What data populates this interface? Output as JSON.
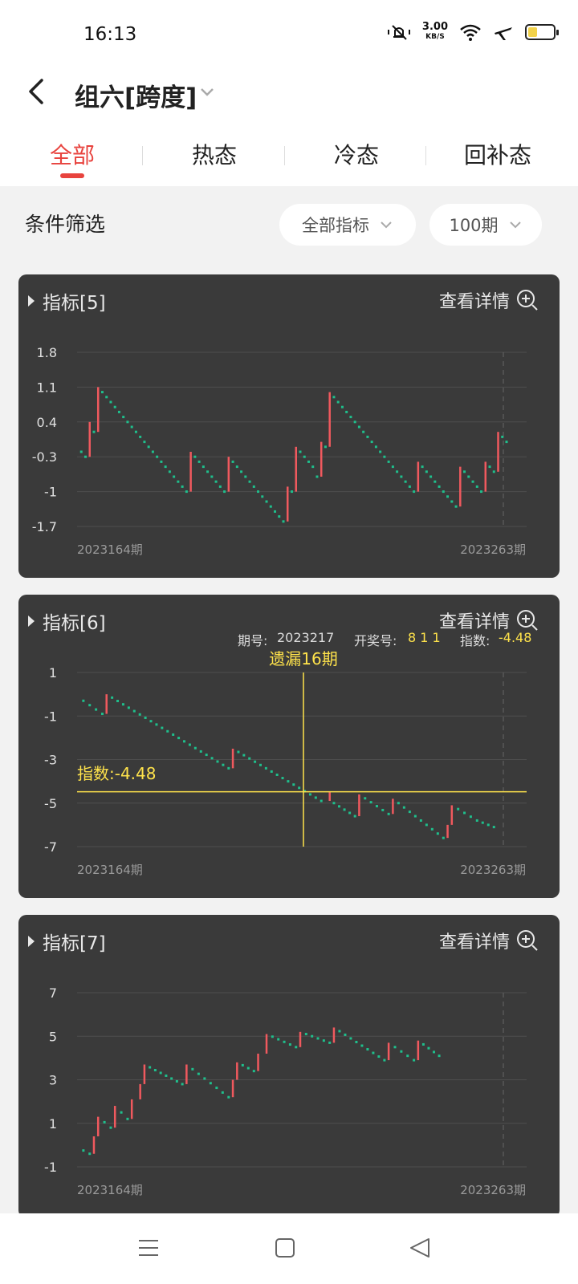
{
  "status": {
    "time": "16:13",
    "net_speed": "3.00",
    "net_unit": "KB/S",
    "battery_level": 0.35
  },
  "header": {
    "title": "组六[跨度]"
  },
  "tabs": [
    {
      "label": "全部"
    },
    {
      "label": "热态"
    },
    {
      "label": "冷态"
    },
    {
      "label": "回补态"
    }
  ],
  "filter": {
    "label": "条件筛选",
    "metric": "全部指标",
    "period": "100期"
  },
  "colors": {
    "accent": "#e8433e",
    "rise": "#f0595e",
    "fall": "#1fbf8c",
    "highlight": "#ffe34b",
    "card_bg": "#3a3a3a"
  },
  "cards": [
    {
      "title": "指标[5]",
      "detail": "查看详情",
      "x_start": "2023164期",
      "x_end": "2023263期"
    },
    {
      "title": "指标[6]",
      "detail": "查看详情",
      "x_start": "2023164期",
      "x_end": "2023263期",
      "tooltip": {
        "issue_label": "期号:",
        "issue": "2023217",
        "draw_label": "开奖号:",
        "draw": "8 1 1",
        "index_label": "指数:",
        "index": "-4.48"
      },
      "cursor_label": "遗漏16期",
      "cursor_value_label": "指数:-4.48"
    },
    {
      "title": "指标[7]",
      "detail": "查看详情",
      "x_start": "2023164期",
      "x_end": "2023263期"
    }
  ],
  "chart_data": [
    {
      "type": "line",
      "title": "指标[5]",
      "yticks": [
        "1.8",
        "1.1",
        "0.4",
        "-0.3",
        "-1",
        "-1.7"
      ],
      "ylim": [
        -1.7,
        1.8
      ],
      "x": [
        "2023164期",
        "2023263期"
      ],
      "series": [
        {
          "points": [
            [
              0,
              -0.1
            ],
            [
              1,
              -0.2
            ],
            [
              2,
              -0.3
            ],
            [
              3,
              0.4
            ],
            [
              4,
              0.2
            ],
            [
              5,
              1.1
            ],
            [
              6,
              1.0
            ],
            [
              7,
              0.9
            ],
            [
              8,
              0.8
            ],
            [
              9,
              0.7
            ],
            [
              10,
              0.6
            ],
            [
              11,
              0.5
            ],
            [
              12,
              0.4
            ],
            [
              13,
              0.3
            ],
            [
              14,
              0.2
            ],
            [
              15,
              0.1
            ],
            [
              16,
              0.0
            ],
            [
              17,
              -0.1
            ],
            [
              18,
              -0.2
            ],
            [
              19,
              -0.3
            ],
            [
              20,
              -0.4
            ],
            [
              21,
              -0.5
            ],
            [
              22,
              -0.6
            ],
            [
              23,
              -0.7
            ],
            [
              24,
              -0.8
            ],
            [
              25,
              -0.9
            ],
            [
              26,
              -1.0
            ],
            [
              27,
              -0.2
            ],
            [
              28,
              -0.3
            ],
            [
              29,
              -0.4
            ],
            [
              30,
              -0.5
            ],
            [
              31,
              -0.6
            ],
            [
              32,
              -0.7
            ],
            [
              33,
              -0.8
            ],
            [
              34,
              -0.9
            ],
            [
              35,
              -1.0
            ],
            [
              36,
              -0.3
            ],
            [
              37,
              -0.4
            ],
            [
              38,
              -0.5
            ],
            [
              39,
              -0.6
            ],
            [
              40,
              -0.7
            ],
            [
              41,
              -0.8
            ],
            [
              42,
              -0.9
            ],
            [
              43,
              -1.0
            ],
            [
              44,
              -1.1
            ],
            [
              45,
              -1.2
            ],
            [
              46,
              -1.3
            ],
            [
              47,
              -1.4
            ],
            [
              48,
              -1.5
            ],
            [
              49,
              -1.6
            ],
            [
              50,
              -0.9
            ],
            [
              51,
              -1.0
            ],
            [
              52,
              -0.1
            ],
            [
              53,
              -0.2
            ],
            [
              54,
              -0.3
            ],
            [
              55,
              -0.4
            ],
            [
              56,
              -0.5
            ],
            [
              57,
              -0.7
            ],
            [
              58,
              0.0
            ],
            [
              59,
              -0.1
            ],
            [
              60,
              1.0
            ],
            [
              61,
              0.9
            ],
            [
              62,
              0.8
            ],
            [
              63,
              0.7
            ],
            [
              64,
              0.6
            ],
            [
              65,
              0.5
            ],
            [
              66,
              0.4
            ],
            [
              67,
              0.3
            ],
            [
              68,
              0.2
            ],
            [
              69,
              0.1
            ],
            [
              70,
              0.0
            ],
            [
              71,
              -0.1
            ],
            [
              72,
              -0.2
            ],
            [
              73,
              -0.3
            ],
            [
              74,
              -0.4
            ],
            [
              75,
              -0.5
            ],
            [
              76,
              -0.6
            ],
            [
              77,
              -0.7
            ],
            [
              78,
              -0.8
            ],
            [
              79,
              -0.9
            ],
            [
              80,
              -1.0
            ],
            [
              81,
              -0.4
            ],
            [
              82,
              -0.5
            ],
            [
              83,
              -0.6
            ],
            [
              84,
              -0.7
            ],
            [
              85,
              -0.8
            ],
            [
              86,
              -0.9
            ],
            [
              87,
              -1.0
            ],
            [
              88,
              -1.1
            ],
            [
              89,
              -1.2
            ],
            [
              90,
              -1.3
            ],
            [
              91,
              -0.5
            ],
            [
              92,
              -0.6
            ],
            [
              93,
              -0.7
            ],
            [
              94,
              -0.8
            ],
            [
              95,
              -0.9
            ],
            [
              96,
              -1.0
            ],
            [
              97,
              -0.4
            ],
            [
              98,
              -0.5
            ],
            [
              99,
              -0.6
            ],
            [
              100,
              0.2
            ],
            [
              101,
              0.1
            ],
            [
              102,
              0.0
            ]
          ]
        }
      ]
    },
    {
      "type": "line",
      "title": "指标[6]",
      "yticks": [
        "1",
        "-1",
        "-3",
        "-5",
        "-7"
      ],
      "ylim": [
        -7,
        1
      ],
      "x": [
        "2023164期",
        "2023263期"
      ],
      "series": [
        {
          "points": [
            [
              0,
              -0.1
            ],
            [
              6,
              -0.9
            ],
            [
              7,
              0.0
            ],
            [
              36,
              -3.4
            ],
            [
              37,
              -2.5
            ],
            [
              58,
              -4.9
            ],
            [
              60,
              -4.5
            ],
            [
              61,
              -5.0
            ],
            [
              66,
              -5.6
            ],
            [
              67,
              -4.6
            ],
            [
              74,
              -5.5
            ],
            [
              75,
              -4.8
            ],
            [
              87,
              -6.6
            ],
            [
              88,
              -6.0
            ],
            [
              89,
              -5.1
            ],
            [
              95,
              -5.8
            ],
            [
              99,
              -6.1
            ]
          ]
        }
      ]
    },
    {
      "type": "line",
      "title": "指标[7]",
      "yticks": [
        "7",
        "5",
        "3",
        "1",
        "-1"
      ],
      "ylim": [
        -1,
        7
      ],
      "x": [
        "2023164期",
        "2023263期"
      ],
      "series": [
        {
          "points": [
            [
              0,
              -0.1
            ],
            [
              3,
              -0.4
            ],
            [
              4,
              0.4
            ],
            [
              5,
              1.3
            ],
            [
              8,
              0.8
            ],
            [
              9,
              1.8
            ],
            [
              12,
              1.2
            ],
            [
              13,
              2.1
            ],
            [
              15,
              2.8
            ],
            [
              16,
              3.7
            ],
            [
              25,
              2.8
            ],
            [
              26,
              3.7
            ],
            [
              36,
              2.2
            ],
            [
              37,
              3.0
            ],
            [
              38,
              3.8
            ],
            [
              42,
              3.4
            ],
            [
              43,
              4.2
            ],
            [
              45,
              5.1
            ],
            [
              52,
              4.5
            ],
            [
              53,
              5.2
            ],
            [
              60,
              4.7
            ],
            [
              61,
              5.4
            ],
            [
              73,
              3.9
            ],
            [
              74,
              4.7
            ],
            [
              80,
              3.9
            ],
            [
              81,
              4.8
            ],
            [
              86,
              4.1
            ]
          ]
        }
      ]
    }
  ]
}
